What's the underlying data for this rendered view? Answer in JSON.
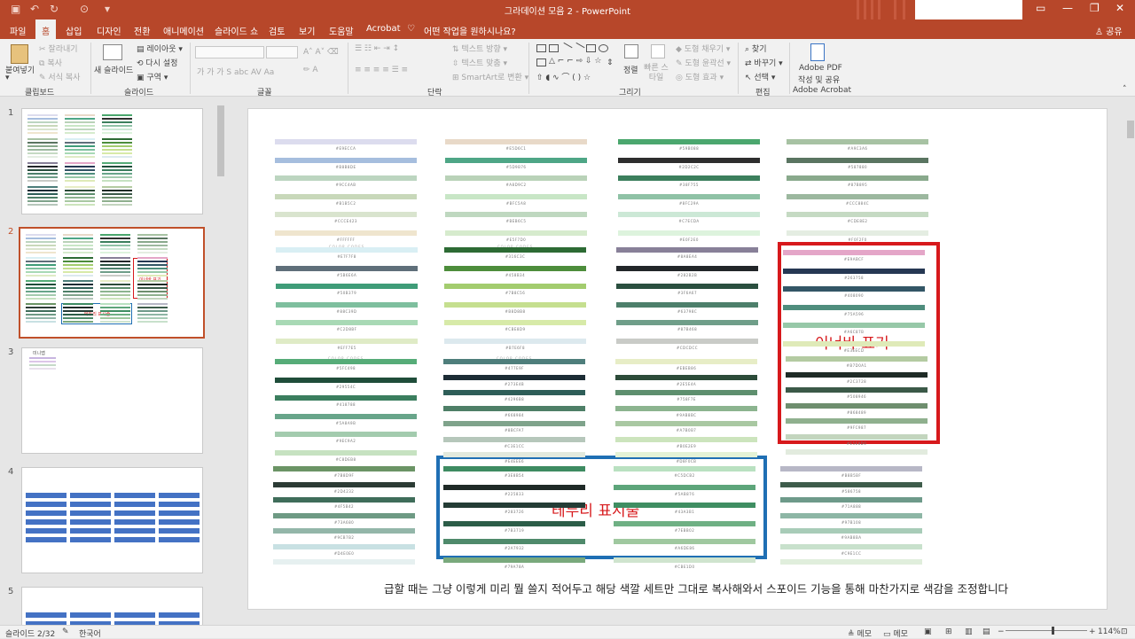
{
  "app": {
    "title": "그라데이션 모음 2  -  PowerPoint",
    "user": "공유"
  },
  "quick_access": {
    "save_icon": "save-icon",
    "undo_icon": "undo-icon",
    "redo_icon": "redo-icon",
    "start_icon": "start-from-beginning-icon",
    "customize_icon": "customize-qat-icon"
  },
  "tabs": [
    {
      "label": "파일"
    },
    {
      "label": "홈"
    },
    {
      "label": "삽입"
    },
    {
      "label": "디자인"
    },
    {
      "label": "전환"
    },
    {
      "label": "애니메이션"
    },
    {
      "label": "슬라이드 쇼"
    },
    {
      "label": "검토"
    },
    {
      "label": "보기"
    },
    {
      "label": "도움말"
    },
    {
      "label": "Acrobat"
    }
  ],
  "tell_me": "어떤 작업을 원하시나요?",
  "ribbon": {
    "clipboard": {
      "paste": "붙여넣기",
      "cut": "잘라내기",
      "copy": "복사",
      "format_painter": "서식 복사",
      "label": "클립보드"
    },
    "slides": {
      "new_slide": "새 슬라이드",
      "layout": "레이아웃",
      "reset": "다시 설정",
      "section": "구역",
      "label": "슬라이드"
    },
    "font": {
      "label": "글꼴"
    },
    "paragraph": {
      "text_direction": "텍스트 방향",
      "align_text": "텍스트 맞춤",
      "smartart": "SmartArt로 변환",
      "label": "단락"
    },
    "drawing": {
      "arrange": "정렬",
      "quick_styles": "빠른 스타일",
      "shape_fill": "도형 채우기",
      "shape_outline": "도형 윤곽선",
      "shape_effects": "도형 효과",
      "label": "그리기"
    },
    "editing": {
      "find": "찾기",
      "replace": "바꾸기",
      "select": "선택",
      "label": "편집"
    },
    "acrobat": {
      "create": "Adobe PDF",
      "create2": "작성 및 공유",
      "label": "Adobe Acrobat"
    }
  },
  "thumbnails": [
    {
      "number": "1"
    },
    {
      "number": "2",
      "inner_label": "이너바 표기",
      "border_label": "테두리 표시줄"
    },
    {
      "number": "3",
      "label": "미니맵"
    },
    {
      "number": "4"
    },
    {
      "number": "5"
    }
  ],
  "slide": {
    "headers": [
      "COLOR CODES",
      "COLOR CODES",
      "COLOR CODES",
      "COLOR CODES"
    ],
    "swatches": [
      {
        "colors": [
          "#DCDCEE",
          "#A6BEDE",
          "#BCD5C0",
          "#C8D8BA",
          "#D9E4CE",
          "#EFE5CE"
        ],
        "hex": [
          "#E9ECCA",
          "#B8B8DE",
          "#9CC4AB",
          "#B1B5C2",
          "#CCCE423",
          "#FFFFFF"
        ]
      },
      {
        "colors": [
          "#E8D9C8",
          "#4EA686",
          "#B9D2B8",
          "#C8E6C6",
          "#BFD8C0",
          "#D6EBCD"
        ],
        "hex": [
          "#E5D6C1",
          "#5D9B76",
          "#A8D9C2",
          "#BFC5A8",
          "#BEB6C5",
          "#E5F7D0"
        ]
      },
      {
        "colors": [
          "#4BA76E",
          "#2E2E2E",
          "#3C7F5D",
          "#8FC2A6",
          "#CCE8D6",
          "#DDF3DD"
        ],
        "hex": [
          "#59B088",
          "#2D2C2C",
          "#38F755",
          "#8FC29A",
          "#C7ECDA",
          "#E0F2E0"
        ]
      },
      {
        "colors": [
          "#A7C2A3",
          "#5A7561",
          "#89A98C",
          "#9CB89F",
          "#C5DAC3",
          "#E4EDE2"
        ],
        "hex": [
          "#A9C3A6",
          "#587880",
          "#87B895",
          "#CCC884C",
          "#CDE8E2",
          "#F0F2F0"
        ]
      },
      {
        "colors": [
          "#D9EFF4",
          "#5F6F7A",
          "#3F9C78",
          "#7EBF9E",
          "#A8D9B5",
          "#DFEBC6"
        ],
        "hex": [
          "#E7F7F8",
          "#5B6E6A",
          "#50B379",
          "#88C39D",
          "#C2D8BF",
          "#EFF7E5"
        ]
      },
      {
        "colors": [
          "#2D6B34",
          "#4D8D3B",
          "#A3CC6E",
          "#C5DF8F",
          "#D7EAA8",
          "#DCE9EE"
        ],
        "hex": [
          "#316C3C",
          "#458B34",
          "#7B8C56",
          "#B8D8B8",
          "#CBE8D9",
          "#B7E6F8"
        ]
      },
      {
        "colors": [
          "#888098",
          "#222629",
          "#2A4F3F",
          "#4D7F6B",
          "#6F9E89",
          "#C9CBC7"
        ],
        "hex": [
          "#8A8EA4",
          "#282B2B",
          "#3F6A67",
          "#63798C",
          "#87B468",
          "#CDCDCC"
        ]
      },
      {
        "colors": [
          "#E4A6C8",
          "#263853",
          "#335666",
          "#4F8D7D",
          "#97C8A8",
          "#DFEAB8"
        ],
        "hex": [
          "#E9ABCF",
          "#263758",
          "#408090",
          "#75A596",
          "#A6C87B",
          "#E3EECD"
        ]
      },
      {
        "colors": [
          "#56AC78",
          "#1F4D3A",
          "#3B7E5E",
          "#68A58A",
          "#A3CBAE",
          "#C6E2C1"
        ],
        "hex": [
          "#5FC498",
          "#29554C",
          "#418788",
          "#5A8A9B",
          "#9EC9A2",
          "#C8DEB8"
        ]
      },
      {
        "colors": [
          "#4E7E7B",
          "#1C2C35",
          "#2E5E58",
          "#4E7F67",
          "#7FA38B",
          "#B6C7BB",
          "#E2E9DD"
        ],
        "hex": [
          "#477E9F",
          "#273E4B",
          "#4296B8",
          "#668984",
          "#8BCFA7",
          "#C3E1CC",
          "#E4EEE6"
        ]
      },
      {
        "colors": [
          "#E7EDC6",
          "#2C4B39",
          "#5E8F6E",
          "#8CB48F",
          "#A9C8A2",
          "#CCE4BD",
          "#E4F2D6"
        ],
        "hex": [
          "#EBEB86",
          "#2E5E4A",
          "#758F7E",
          "#9AB8BC",
          "#A7B0B7",
          "#B0E2E9",
          "#D8F0CB"
        ]
      },
      {
        "colors": [
          "#B4CBA2",
          "#1F2B26",
          "#3B5948",
          "#6E8E6E",
          "#8FB08E",
          "#C3D5BE",
          "#E2EBDE"
        ],
        "hex": [
          "#B7D0A1",
          "#2C3728",
          "#508946",
          "#868489",
          "#9FC987",
          "#E5E8D0"
        ]
      },
      {
        "colors": [
          "#6B9465",
          "#2C3B35",
          "#3F6D5A",
          "#6E9A84",
          "#93B6A9",
          "#C8E1E3",
          "#E6F0F0"
        ],
        "hex": [
          "#7B8D9F",
          "#2D4232",
          "#4F5B42",
          "#73A680",
          "#9CB7B2",
          "#D4E0E0"
        ]
      },
      {
        "colors": [
          "#3E8B62",
          "#1F2A27",
          "#243C35",
          "#2C5D48",
          "#4F8A6B",
          "#79A97C"
        ],
        "hex": [
          "#3E8B54",
          "#225833",
          "#283726",
          "#7B3719",
          "#2A7932",
          "#79A78A"
        ]
      },
      {
        "colors": [
          "#B9E1C1",
          "#5DA57A",
          "#3F8E62",
          "#6FB084",
          "#9FC89F",
          "#CFE4CE"
        ],
        "hex": [
          "#C5DCB2",
          "#5AB876",
          "#43A3B1",
          "#7EBB02",
          "#A6DE86",
          "#CBE1D0"
        ]
      },
      {
        "colors": [
          "#B7B7C6",
          "#3E5C4B",
          "#6E9A8A",
          "#8DB6A5",
          "#A8CCB8",
          "#C8E1CC",
          "#E0EEDC"
        ],
        "hex": [
          "#B8B5BF",
          "#586758",
          "#71A888",
          "#97B108",
          "#9AB8BA",
          "#C9E1CC"
        ]
      }
    ],
    "inner_label": "이너바 표기",
    "border_label": "테두리 표시줄",
    "caption": "급할 때는 그냥 이렇게 미리 뭘 쓸지 적어두고 해당 색깔 세트만 그대로 복사해와서 스포이드 기능을 통해 마찬가지로 색감을 조정합니다"
  },
  "status": {
    "slide_count": "슬라이드 2/32",
    "language": "한국어",
    "notes": "메모",
    "comments": "메모",
    "zoom": "114%"
  },
  "colors": {
    "accent": "#b7472a",
    "red_frame": "#d7191c",
    "blue_frame": "#1f6fb4"
  }
}
